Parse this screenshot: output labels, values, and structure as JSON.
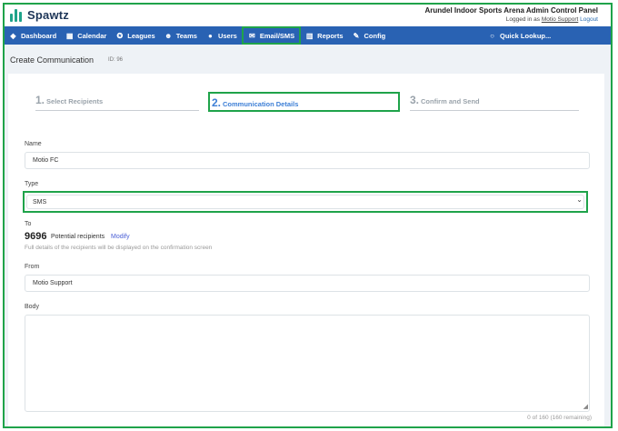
{
  "app": {
    "name": "Spawtz",
    "panel_title": "Arundel Indoor Sports Arena Admin Control Panel",
    "logged_in_prefix": "Logged in as",
    "user": "Motio Support",
    "logout": "Logout"
  },
  "nav": {
    "items": [
      {
        "label": "Dashboard",
        "icon": "layers-icon",
        "glyph": "◆"
      },
      {
        "label": "Calendar",
        "icon": "calendar-icon",
        "glyph": "▦"
      },
      {
        "label": "Leagues",
        "icon": "trophy-icon",
        "glyph": "✪"
      },
      {
        "label": "Teams",
        "icon": "people-icon",
        "glyph": "☻"
      },
      {
        "label": "Users",
        "icon": "user-icon",
        "glyph": "●"
      },
      {
        "label": "Email/SMS",
        "icon": "envelope-icon",
        "glyph": "✉"
      },
      {
        "label": "Reports",
        "icon": "bar-chart-icon",
        "glyph": "▥"
      },
      {
        "label": "Config",
        "icon": "wrench-icon",
        "glyph": "✎"
      }
    ],
    "active": "Email/SMS",
    "lookup": {
      "label": "Quick Lookup...",
      "icon": "search-icon",
      "glyph": "○"
    }
  },
  "page": {
    "title": "Create Communication",
    "id_label": "ID: 96"
  },
  "steps": [
    {
      "num": "1.",
      "label": "Select Recipients"
    },
    {
      "num": "2.",
      "label": "Communication Details"
    },
    {
      "num": "3.",
      "label": "Confirm and Send"
    }
  ],
  "form": {
    "name_label": "Name",
    "name_value": "Motio FC",
    "type_label": "Type",
    "type_value": "SMS",
    "to_label": "To",
    "recipient_count": "9696",
    "recipients_label": "Potential recipients",
    "modify": "Modify",
    "recipients_hint": "Full details of the recipients will be displayed on the confirmation screen",
    "from_label": "From",
    "from_value": "Motio Support",
    "body_label": "Body",
    "body_value": "",
    "char_counter": "0 of 160 (160 remaining)"
  },
  "colors": {
    "nav_bg": "#2962b3",
    "highlight": "#1fa34a",
    "active_step": "#3d7fd6",
    "brand_mark": "#1fa38a"
  }
}
